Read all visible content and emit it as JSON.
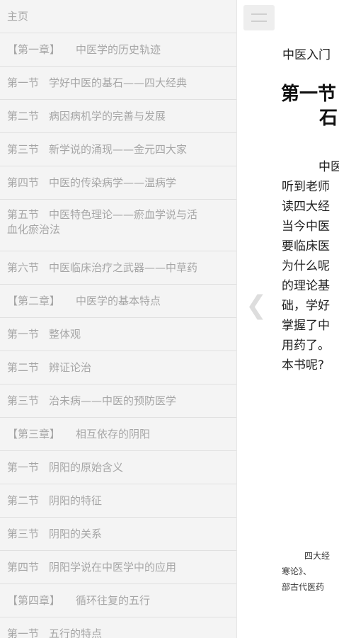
{
  "toc": {
    "home": "主页",
    "items": [
      {
        "kind": "chapter",
        "sec": "【第一章】",
        "title": "中医学的历史轨迹"
      },
      {
        "kind": "section",
        "sec": "第一节",
        "title": "学好中医的基石——四大经典"
      },
      {
        "kind": "section",
        "sec": "第二节",
        "title": "病因病机学的完善与发展"
      },
      {
        "kind": "section",
        "sec": "第三节",
        "title": "新学说的涌现——金元四大家"
      },
      {
        "kind": "section",
        "sec": "第四节",
        "title": "中医的传染病学——温病学"
      },
      {
        "kind": "section",
        "sec": "第五节",
        "title": "中医特色理论——瘀血学说与活",
        "title2": "血化瘀治法"
      },
      {
        "kind": "section",
        "sec": "第六节",
        "title": "中医临床治疗之武器——中草药"
      },
      {
        "kind": "chapter",
        "sec": "【第二章】",
        "title": "中医学的基本特点"
      },
      {
        "kind": "section",
        "sec": "第一节",
        "title": "整体观"
      },
      {
        "kind": "section",
        "sec": "第二节",
        "title": "辨证论治"
      },
      {
        "kind": "section",
        "sec": "第三节",
        "title": "治未病——中医的预防医学"
      },
      {
        "kind": "chapter",
        "sec": "【第三章】",
        "title": "相互依存的阴阳"
      },
      {
        "kind": "section",
        "sec": "第一节",
        "title": "阴阳的原始含义"
      },
      {
        "kind": "section",
        "sec": "第二节",
        "title": "阴阳的特征"
      },
      {
        "kind": "section",
        "sec": "第三节",
        "title": "阴阳的关系"
      },
      {
        "kind": "section",
        "sec": "第四节",
        "title": "阴阳学说在中医学中的应用"
      },
      {
        "kind": "chapter",
        "sec": "【第四章】",
        "title": "循环往复的五行"
      },
      {
        "kind": "section",
        "sec": "第一节",
        "title": "五行的特点"
      }
    ]
  },
  "reader": {
    "book_title": "中医入门",
    "chapter_title": [
      "第一节",
      "石"
    ],
    "paragraph_lines": [
      "中医",
      "听到老师",
      "读四大经",
      "当今中医",
      "要临床医",
      "为什么呢",
      "的理论基",
      "础，学好",
      "掌握了中",
      "用药了。",
      "本书呢?"
    ],
    "footnote_lines": [
      "四大经",
      "寒论》、",
      "部古代医药"
    ],
    "back_icon": "chevron-left-icon",
    "menu_icon": "hamburger-menu-icon"
  }
}
